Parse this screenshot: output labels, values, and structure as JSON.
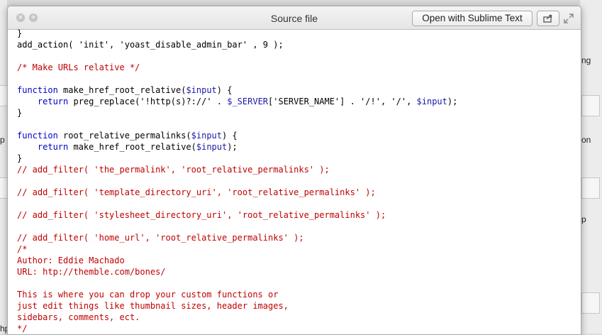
{
  "window": {
    "title": "Source file"
  },
  "toolbar": {
    "open_label": "Open with Sublime Text"
  },
  "background": {
    "labels": [
      "ng",
      "on",
      "hp",
      "p",
      "hp"
    ]
  },
  "code_lines": [
    {
      "type": "plain",
      "text": "}"
    },
    {
      "type": "plain",
      "text": "add_action( 'init', 'yoast_disable_admin_bar' , 9 );"
    },
    {
      "type": "blank",
      "text": ""
    },
    {
      "type": "comment",
      "text": "/* Make URLs relative */"
    },
    {
      "type": "blank",
      "text": ""
    },
    {
      "type": "func",
      "kw": "function",
      "text": " make_href_root_relative(",
      "var": "$input",
      "tail": ") {"
    },
    {
      "type": "return1",
      "kw": "    return",
      "text": " preg_replace('!http(s)?://' . ",
      "var": "$_SERVER",
      "mid": "['SERVER_NAME'] . '/!', '/', ",
      "var2": "$input",
      "tail": ");"
    },
    {
      "type": "plain",
      "text": "}"
    },
    {
      "type": "blank",
      "text": ""
    },
    {
      "type": "func",
      "kw": "function",
      "text": " root_relative_permalinks(",
      "var": "$input",
      "tail": ") {"
    },
    {
      "type": "return2",
      "kw": "    return",
      "text": " make_href_root_relative(",
      "var": "$input",
      "tail": ");"
    },
    {
      "type": "plain",
      "text": "}"
    },
    {
      "type": "comment",
      "text": "// add_filter( 'the_permalink', 'root_relative_permalinks' );"
    },
    {
      "type": "blank",
      "text": ""
    },
    {
      "type": "comment",
      "text": "// add_filter( 'template_directory_uri', 'root_relative_permalinks' );"
    },
    {
      "type": "blank",
      "text": ""
    },
    {
      "type": "comment",
      "text": "// add_filter( 'stylesheet_directory_uri', 'root_relative_permalinks' );"
    },
    {
      "type": "blank",
      "text": ""
    },
    {
      "type": "comment",
      "text": "// add_filter( 'home_url', 'root_relative_permalinks' );"
    },
    {
      "type": "comment",
      "text": "/*"
    },
    {
      "type": "comment",
      "text": "Author: Eddie Machado"
    },
    {
      "type": "comment",
      "text": "URL: htp://themble.com/bones/"
    },
    {
      "type": "blank",
      "text": ""
    },
    {
      "type": "comment",
      "text": "This is where you can drop your custom functions or"
    },
    {
      "type": "comment",
      "text": "just edit things like thumbnail sizes, header images,"
    },
    {
      "type": "comment",
      "text": "sidebars, comments, ect."
    },
    {
      "type": "comment",
      "text": "*/"
    }
  ],
  "colors": {
    "keyword": "#0000cc",
    "variable": "#1a1aa6",
    "comment": "#c00000"
  },
  "icons": [
    "close-icon",
    "zoom-icon",
    "share-icon",
    "expand-icon"
  ]
}
